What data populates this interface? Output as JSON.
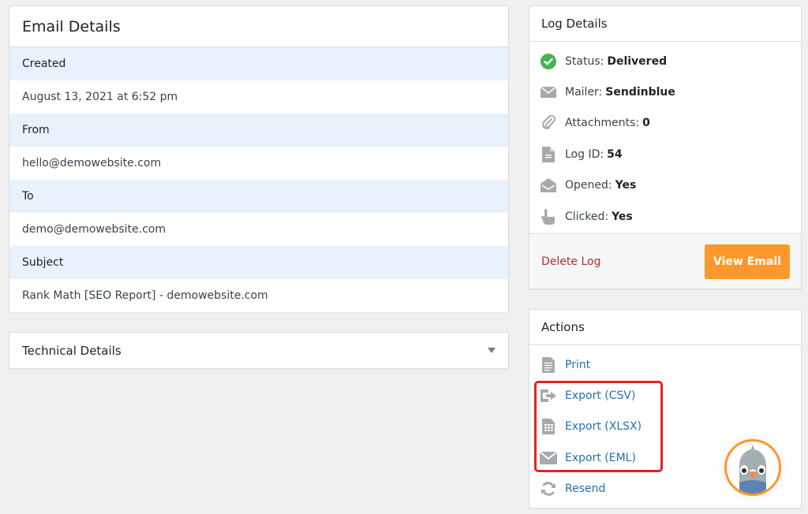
{
  "email_details": {
    "title": "Email Details",
    "fields": [
      {
        "label": "Created",
        "value": "August 13, 2021 at 6:52 pm"
      },
      {
        "label": "From",
        "value": "hello@demowebsite.com"
      },
      {
        "label": "To",
        "value": "demo@demowebsite.com"
      },
      {
        "label": "Subject",
        "value": "Rank Math [SEO Report] - demowebsite.com"
      }
    ]
  },
  "technical_details": {
    "title": "Technical Details",
    "icon": "caret-down-icon"
  },
  "log_details": {
    "title": "Log Details",
    "items": [
      {
        "icon": "check-circle-icon",
        "label": "Status:",
        "value": "Delivered"
      },
      {
        "icon": "envelope-icon",
        "label": "Mailer:",
        "value": "Sendinblue"
      },
      {
        "icon": "paperclip-icon",
        "label": "Attachments:",
        "value": "0"
      },
      {
        "icon": "document-icon",
        "label": "Log ID:",
        "value": "54"
      },
      {
        "icon": "envelope-open-icon",
        "label": "Opened:",
        "value": "Yes"
      },
      {
        "icon": "pointer-hand-icon",
        "label": "Clicked:",
        "value": "Yes"
      }
    ],
    "delete_label": "Delete Log",
    "view_label": "View Email"
  },
  "actions": {
    "title": "Actions",
    "items": [
      {
        "icon": "print-icon",
        "label": "Print"
      },
      {
        "icon": "export-icon",
        "label": "Export (CSV)"
      },
      {
        "icon": "spreadsheet-icon",
        "label": "Export (XLSX)"
      },
      {
        "icon": "envelope-icon",
        "label": "Export (EML)"
      },
      {
        "icon": "refresh-icon",
        "label": "Resend"
      }
    ]
  },
  "colors": {
    "accent": "#ff982b",
    "link": "#2271b1",
    "danger": "#b32d2e",
    "success": "#46b450",
    "highlight": "#e52222",
    "label_row_bg": "#e9f1fa"
  }
}
